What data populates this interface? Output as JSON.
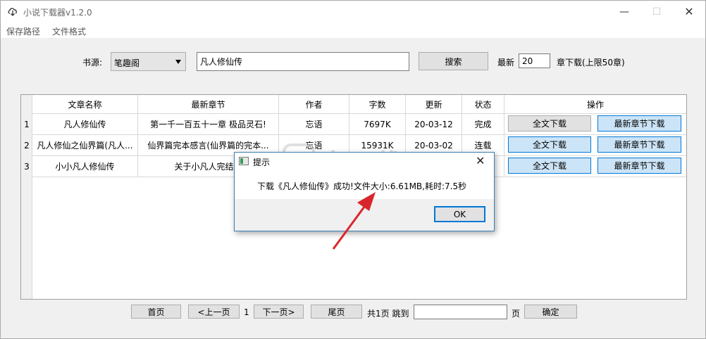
{
  "window": {
    "title": "小说下载器v1.2.0",
    "controls": {
      "minimize": "—",
      "maximize": "☐",
      "close": "✕"
    }
  },
  "menu": [
    "保存路径",
    "文件格式"
  ],
  "search": {
    "source_label": "书源:",
    "source_value": "笔趣阁",
    "query": "凡人修仙传",
    "search_button": "搜索",
    "latest_label": "最新",
    "latest_value": "20",
    "latest_suffix": "章下载(上限50章)"
  },
  "table": {
    "headers": [
      "文章名称",
      "最新章节",
      "作者",
      "字数",
      "更新",
      "状态",
      "操作"
    ],
    "rows": [
      {
        "num": "1",
        "title": "凡人修仙传",
        "chapter": "第一千一百五十一章 极品灵石!",
        "author": "忘语",
        "words": "7697K",
        "updated": "20-03-12",
        "status": "完成",
        "full_btn": "全文下载",
        "latest_btn": "最新章节下载"
      },
      {
        "num": "2",
        "title": "凡人修仙之仙界篇(凡人...",
        "chapter": "仙界篇完本感言(仙界篇的完本...",
        "author": "忘语",
        "words": "15931K",
        "updated": "20-03-02",
        "status": "连载",
        "full_btn": "全文下载",
        "latest_btn": "最新章节下载"
      },
      {
        "num": "3",
        "title": "小小凡人修仙传",
        "chapter": "关于小凡人完结和",
        "author": "",
        "words": "",
        "updated": "",
        "status": "",
        "full_btn": "全文下载",
        "latest_btn": "最新章节下载"
      }
    ]
  },
  "pagination": {
    "first": "首页",
    "prev": "<上一页",
    "current": "1",
    "next": "下一页>",
    "last": "尾页",
    "total": "共1页 跳到",
    "jump_value": "",
    "page_suffix": "页",
    "confirm": "确定"
  },
  "dialog": {
    "title": "提示",
    "message": "下载《凡人修仙传》成功!文件大小:6.61MB,耗时:7.5秒",
    "ok": "OK",
    "close": "✕"
  },
  "watermark": {
    "text": "安下载",
    "sub": "anxz.com"
  },
  "colors": {
    "accent": "#0078d7",
    "button_blue": "#cce4f7",
    "arrow": "#d9262b"
  }
}
